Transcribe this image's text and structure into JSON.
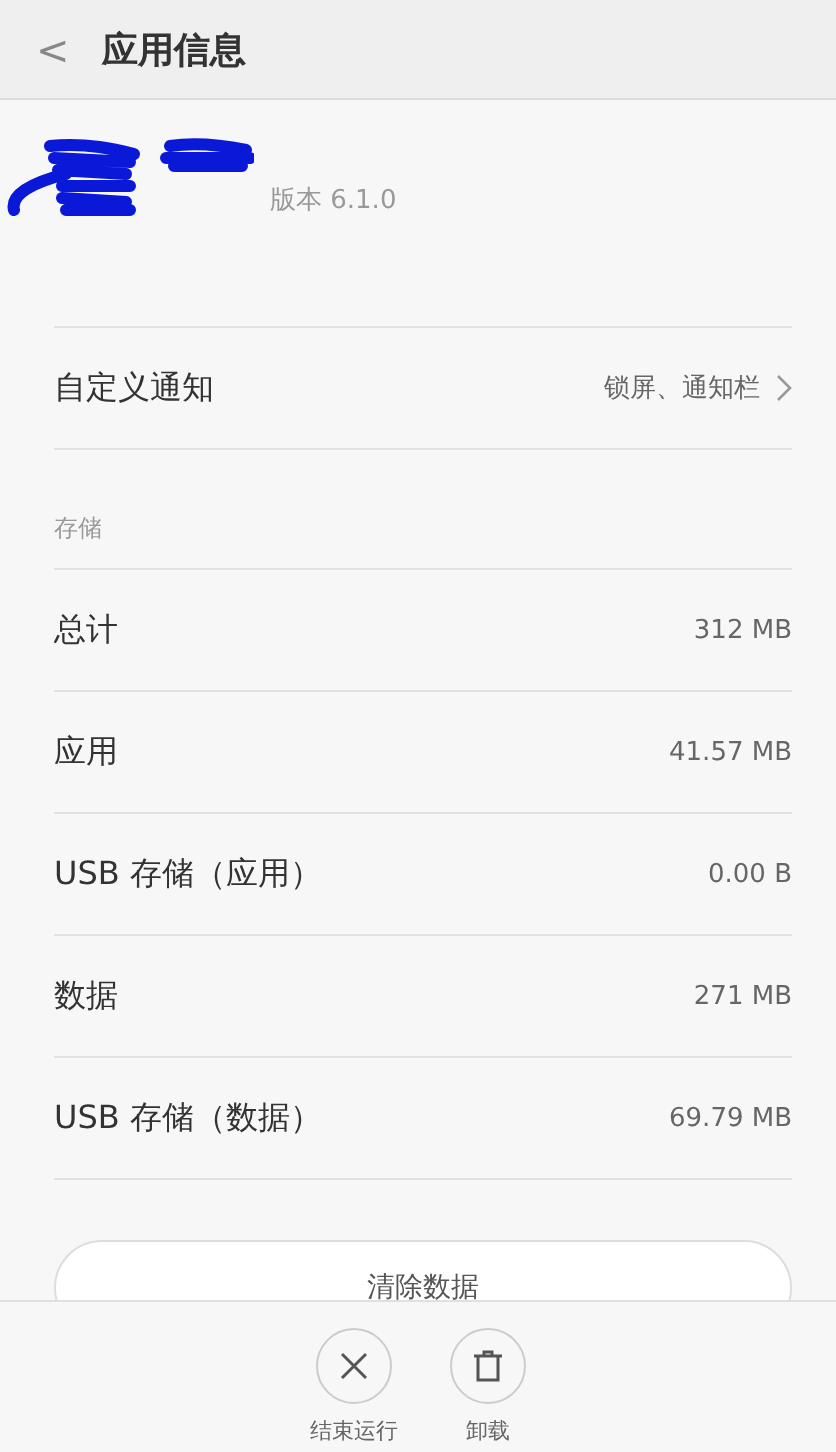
{
  "header": {
    "back": "<",
    "title": "应用信息"
  },
  "app": {
    "version": "版本 6.1.0"
  },
  "notification": {
    "label": "自定义通知",
    "value": "锁屏、通知栏"
  },
  "storage": {
    "heading": "存储",
    "rows": [
      {
        "label": "总计",
        "value": "312 MB"
      },
      {
        "label": "应用",
        "value": "41.57 MB"
      },
      {
        "label": "USB 存储（应用）",
        "value": "0.00 B"
      },
      {
        "label": "数据",
        "value": "271 MB"
      },
      {
        "label": "USB 存储（数据）",
        "value": "69.79 MB"
      }
    ]
  },
  "clear_button": "清除数据",
  "actions": [
    {
      "kind": "stop",
      "label": "结束运行"
    },
    {
      "kind": "uninstall",
      "label": "卸载"
    }
  ]
}
